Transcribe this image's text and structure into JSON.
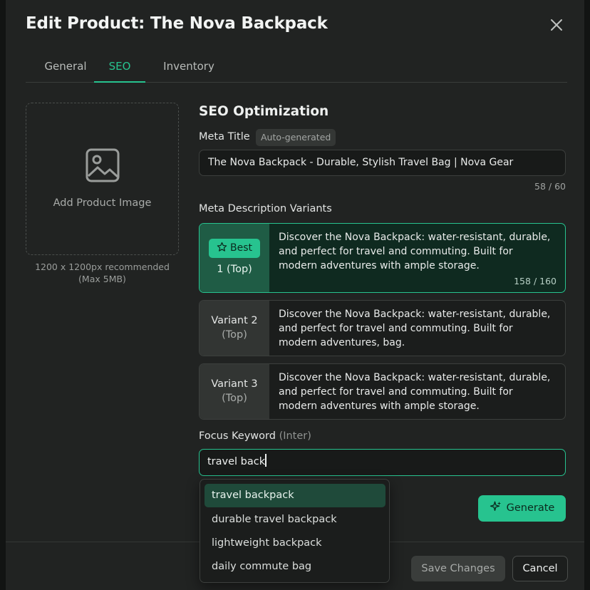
{
  "modal": {
    "title": "Edit Product: The Nova Backpack"
  },
  "tabs": [
    {
      "label": "General",
      "active": false
    },
    {
      "label": "SEO",
      "active": true
    },
    {
      "label": "Inventory",
      "active": false
    }
  ],
  "image_upload": {
    "label": "Add Product Image",
    "hint_line1": "1200 x 1200px recommended",
    "hint_line2": "(Max 5MB)",
    "icon": "image-icon"
  },
  "seo": {
    "section_title": "SEO Optimization",
    "meta_title_label": "Meta Title",
    "meta_title_badge": "Auto-generated",
    "meta_title_value": "The Nova Backpack - Durable, Stylish Travel Bag | Nova Gear",
    "meta_title_counter": "58 / 60",
    "meta_desc_label": "Meta Description Variants",
    "variants": [
      {
        "badge": "Best",
        "line1": "",
        "line2": "1 (Top)",
        "text_l1": "Discover the Nova Backpack: water-resistant, durable,",
        "text_l2": "and perfect for travel and commuting. Built for",
        "text_l3": "modern adventures with ample storage.",
        "counter": "158 / 160"
      },
      {
        "line1": "Variant 2",
        "line2": "(Top)",
        "text_l1": "Discover the Nova Backpack: water-resistant, durable,",
        "text_l2": "and perfect for travel and commuting. Built for",
        "text_l3": "modern adventures, bag."
      },
      {
        "line1": "Variant 3",
        "line2": "(Top)",
        "text_l1": "Discover the Nova Backpack: water-resistant, durable,",
        "text_l2": "and perfect for travel and commuting. Built for",
        "text_l3": "modern adventures with ample storage."
      }
    ],
    "focus_label": "Focus Keyword",
    "focus_label_hint": "(Inter)",
    "focus_value": "travel back",
    "suggestions": [
      "travel backpack",
      "durable travel backpack",
      "lightweight backpack",
      "daily commute bag"
    ],
    "generate_label": "Generate"
  },
  "footer": {
    "save_label": "Save Changes",
    "cancel_label": "Cancel"
  },
  "colors": {
    "accent": "#27c38f",
    "background": "#212322"
  }
}
